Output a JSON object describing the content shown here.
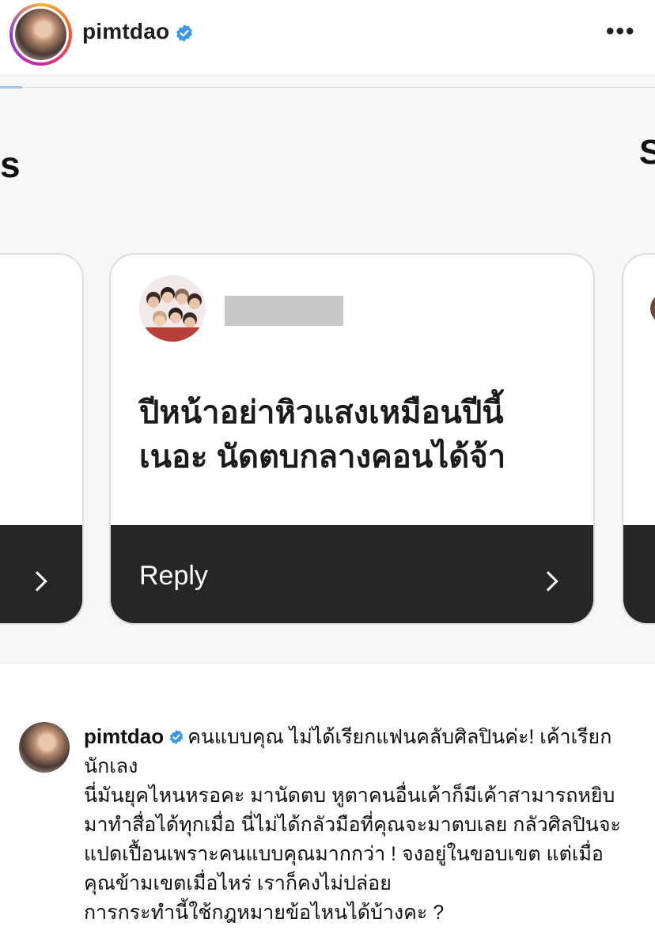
{
  "header": {
    "username": "pimtdao",
    "more_icon": "•••"
  },
  "post": {
    "edge_left_text": "s",
    "edge_right_text": "S",
    "card": {
      "question_line1": "ปีหน้าอย่าหิวแสงเหมือนปีนี้",
      "question_line2": "เนอะ นัดตบกลางคอนได้จ้า",
      "reply_label": "Reply"
    }
  },
  "caption": {
    "username": "pimtdao",
    "line1": "คนแบบคุณ ไม่ได้เรียกแฟนคลับศิลปินค่ะ! เค้าเรียกนักเลง",
    "line2": "นี่มันยุคไหนหรอคะ มานัดตบ หูตาคนอื่นเค้าก็มีเค้าสามารถหยิบมาทำสื่อได้ทุกเมื่อ นี่ไม่ได้กลัวมือที่คุณจะมาตบเลย กลัวศิลปินจะแปดเปื้อนเพราะคนแบบคุณมากกว่า ! จงอยู่ในขอบเขต แต่เมื่อคุณข้ามเขตเมื่อไหร่ เราก็คงไม่ปล่อย",
    "line3": "การกระทำนี้ใช้กฎหมายข้อไหนได้บ้างคะ ?"
  },
  "colors": {
    "verified": "#3897f0",
    "reply_bar": "#262626",
    "redaction": "#c8c8c8"
  }
}
